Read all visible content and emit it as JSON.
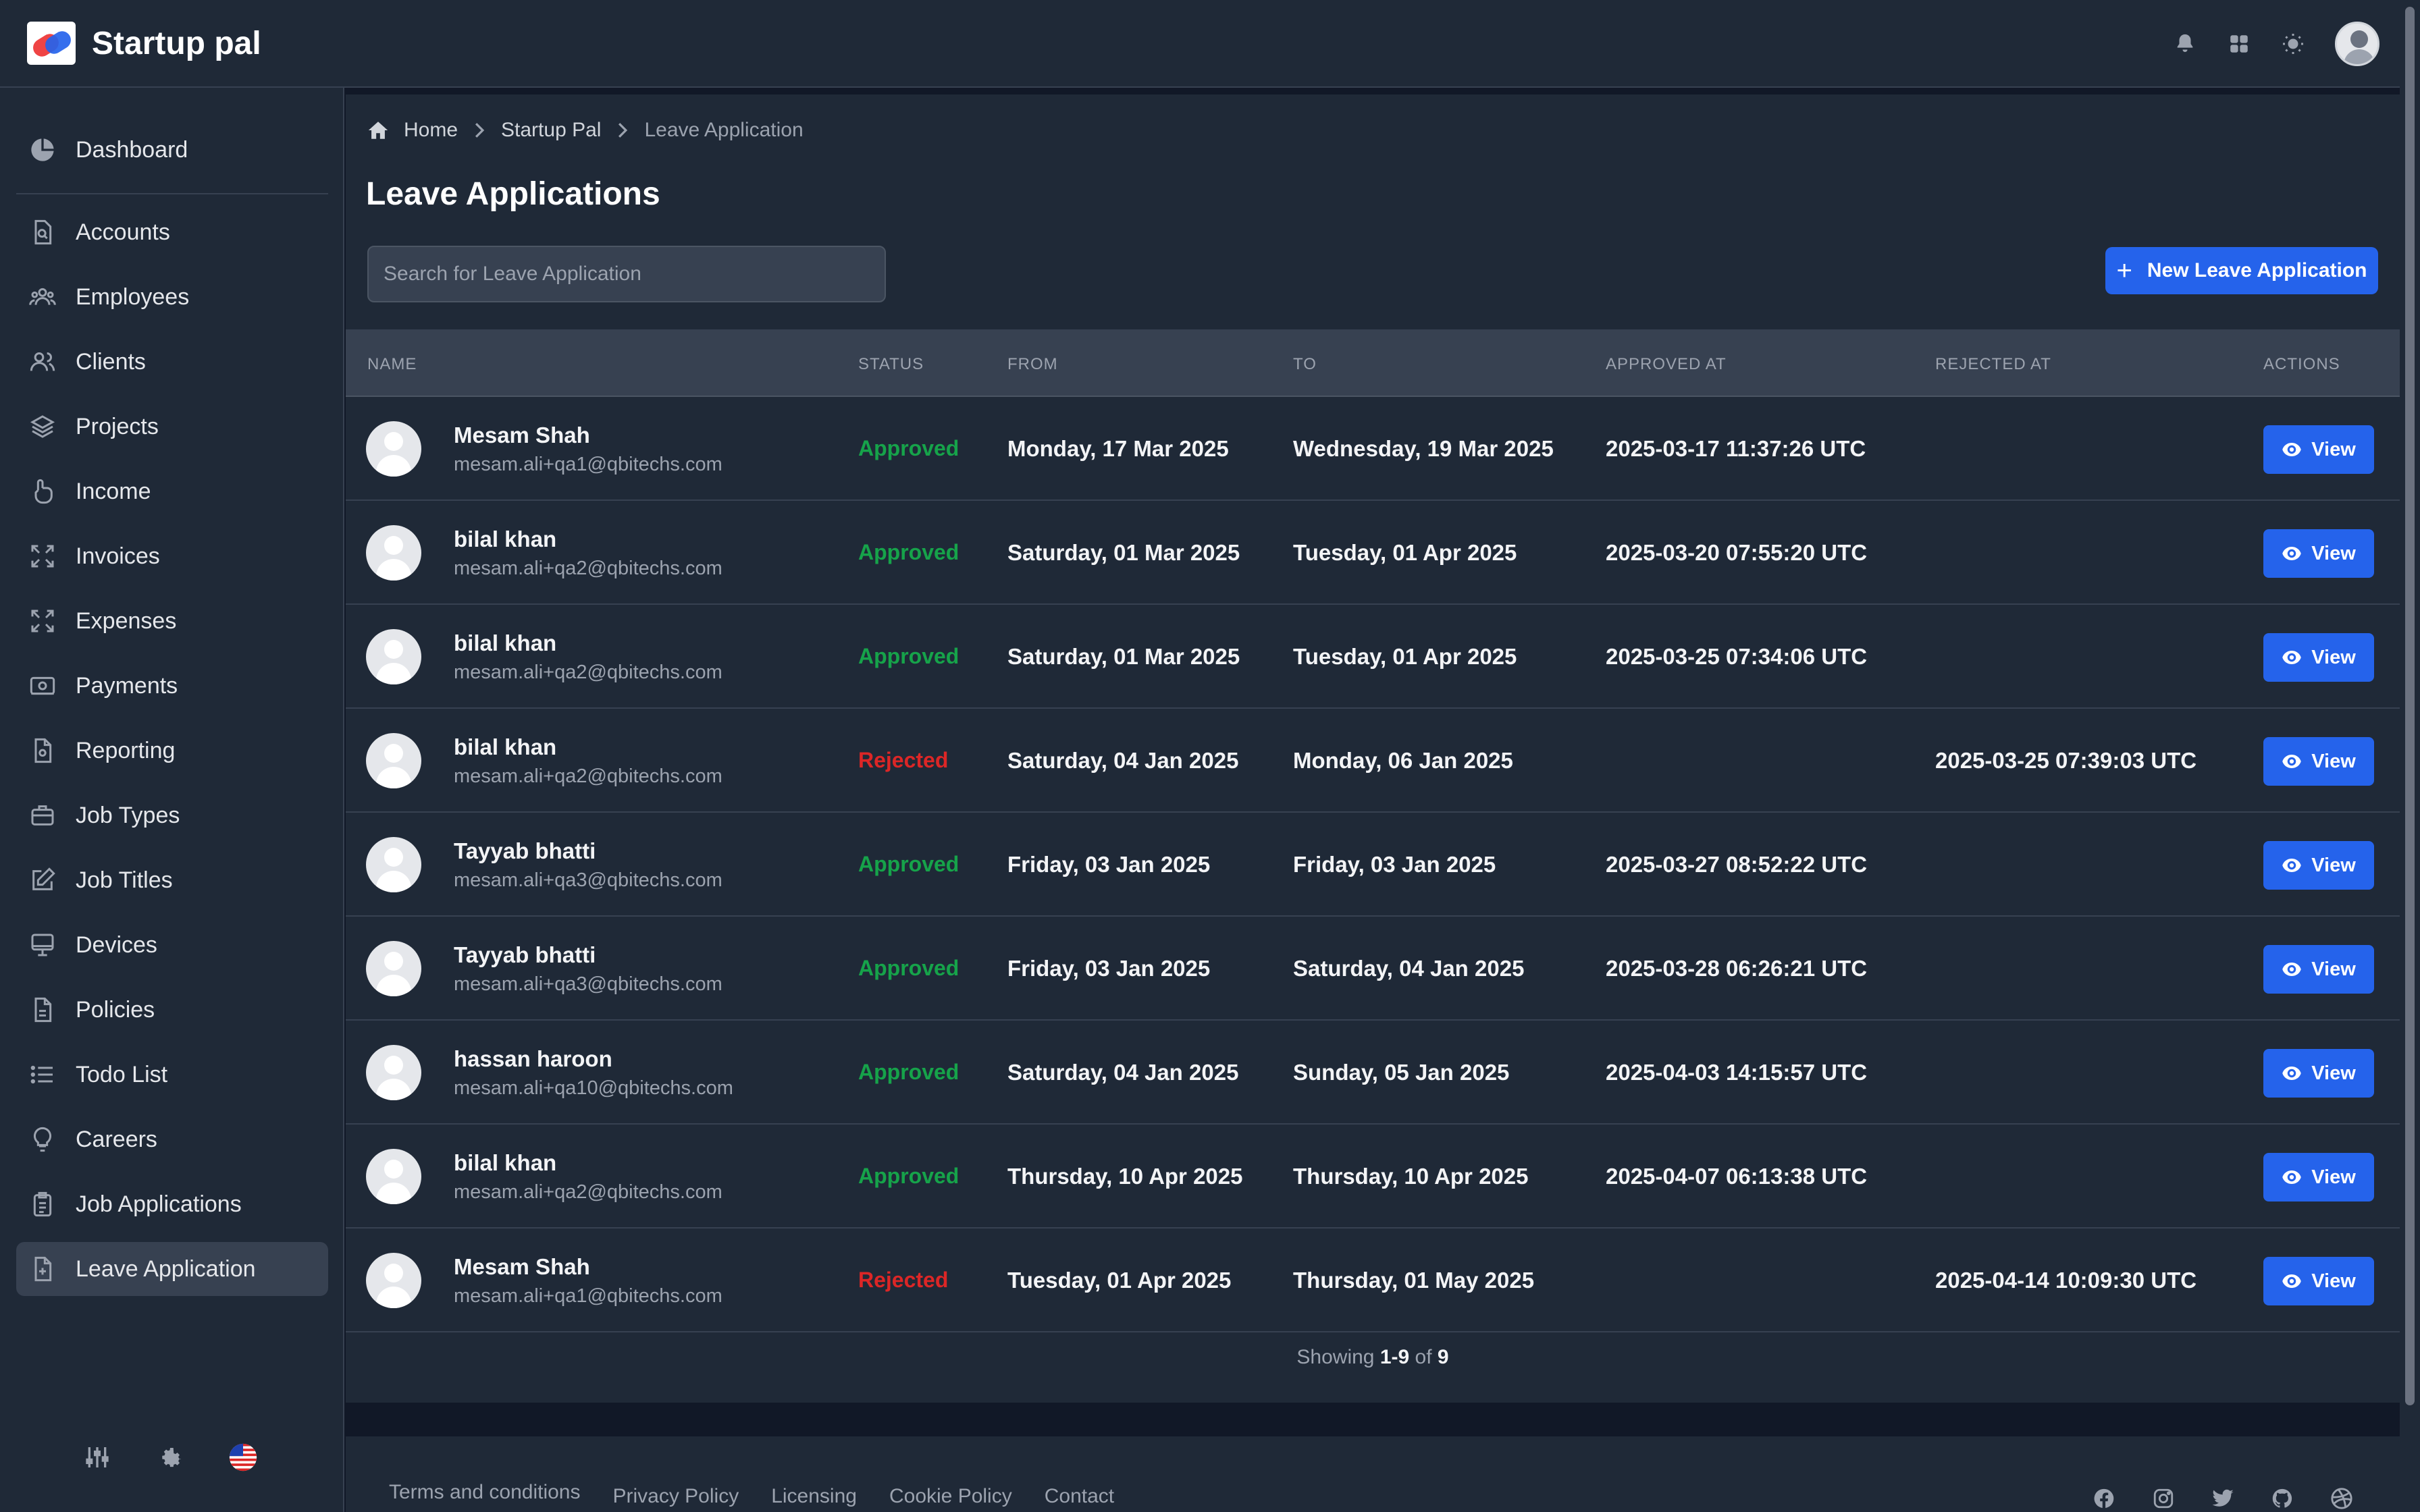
{
  "app": {
    "title": "Startup pal"
  },
  "breadcrumb": [
    "Home",
    "Startup Pal",
    "Leave Application"
  ],
  "page": {
    "title": "Leave Applications",
    "search_placeholder": "Search for Leave Application",
    "new_button_label": "New Leave Application"
  },
  "sidebar": {
    "items": [
      {
        "label": "Dashboard",
        "icon": "pie-chart-icon"
      },
      {
        "label": "Accounts",
        "icon": "document-search-icon"
      },
      {
        "label": "Employees",
        "icon": "user-group-icon"
      },
      {
        "label": "Clients",
        "icon": "users-icon"
      },
      {
        "label": "Projects",
        "icon": "layers-icon"
      },
      {
        "label": "Income",
        "icon": "hand-coin-icon"
      },
      {
        "label": "Invoices",
        "icon": "expand-icon"
      },
      {
        "label": "Expenses",
        "icon": "expand-icon"
      },
      {
        "label": "Payments",
        "icon": "cash-icon"
      },
      {
        "label": "Reporting",
        "icon": "document-icon"
      },
      {
        "label": "Job Types",
        "icon": "briefcase-icon"
      },
      {
        "label": "Job Titles",
        "icon": "pencil-square-icon"
      },
      {
        "label": "Devices",
        "icon": "monitor-icon"
      },
      {
        "label": "Policies",
        "icon": "document-text-icon"
      },
      {
        "label": "Todo List",
        "icon": "list-icon"
      },
      {
        "label": "Careers",
        "icon": "lightbulb-icon"
      },
      {
        "label": "Job Applications",
        "icon": "clipboard-icon"
      },
      {
        "label": "Leave Application",
        "icon": "document-plus-icon"
      }
    ],
    "active": "Leave Application"
  },
  "table": {
    "columns": [
      "NAME",
      "STATUS",
      "FROM",
      "TO",
      "APPROVED AT",
      "REJECTED AT",
      "ACTIONS"
    ],
    "view_label": "View",
    "rows": [
      {
        "name": "Mesam Shah",
        "email": "mesam.ali+qa1@qbitechs.com",
        "status": "Approved",
        "from": "Monday, 17 Mar 2025",
        "to": "Wednesday, 19 Mar 2025",
        "approved_at": "2025-03-17 11:37:26 UTC",
        "rejected_at": ""
      },
      {
        "name": "bilal khan",
        "email": "mesam.ali+qa2@qbitechs.com",
        "status": "Approved",
        "from": "Saturday, 01 Mar 2025",
        "to": "Tuesday, 01 Apr 2025",
        "approved_at": "2025-03-20 07:55:20 UTC",
        "rejected_at": ""
      },
      {
        "name": "bilal khan",
        "email": "mesam.ali+qa2@qbitechs.com",
        "status": "Approved",
        "from": "Saturday, 01 Mar 2025",
        "to": "Tuesday, 01 Apr 2025",
        "approved_at": "2025-03-25 07:34:06 UTC",
        "rejected_at": ""
      },
      {
        "name": "bilal khan",
        "email": "mesam.ali+qa2@qbitechs.com",
        "status": "Rejected",
        "from": "Saturday, 04 Jan 2025",
        "to": "Monday, 06 Jan 2025",
        "approved_at": "",
        "rejected_at": "2025-03-25 07:39:03 UTC"
      },
      {
        "name": "Tayyab bhatti",
        "email": "mesam.ali+qa3@qbitechs.com",
        "status": "Approved",
        "from": "Friday, 03 Jan 2025",
        "to": "Friday, 03 Jan 2025",
        "approved_at": "2025-03-27 08:52:22 UTC",
        "rejected_at": ""
      },
      {
        "name": "Tayyab bhatti",
        "email": "mesam.ali+qa3@qbitechs.com",
        "status": "Approved",
        "from": "Friday, 03 Jan 2025",
        "to": "Saturday, 04 Jan 2025",
        "approved_at": "2025-03-28 06:26:21 UTC",
        "rejected_at": ""
      },
      {
        "name": "hassan haroon",
        "email": "mesam.ali+qa10@qbitechs.com",
        "status": "Approved",
        "from": "Saturday, 04 Jan 2025",
        "to": "Sunday, 05 Jan 2025",
        "approved_at": "2025-04-03 14:15:57 UTC",
        "rejected_at": ""
      },
      {
        "name": "bilal khan",
        "email": "mesam.ali+qa2@qbitechs.com",
        "status": "Approved",
        "from": "Thursday, 10 Apr 2025",
        "to": "Thursday, 10 Apr 2025",
        "approved_at": "2025-04-07 06:13:38 UTC",
        "rejected_at": ""
      },
      {
        "name": "Mesam Shah",
        "email": "mesam.ali+qa1@qbitechs.com",
        "status": "Rejected",
        "from": "Tuesday, 01 Apr 2025",
        "to": "Thursday, 01 May 2025",
        "approved_at": "",
        "rejected_at": "2025-04-14 10:09:30 UTC"
      }
    ]
  },
  "pagination": {
    "prefix": "Showing",
    "range": "1-9",
    "of": "of",
    "total": "9"
  },
  "footer": {
    "links": [
      "Terms and conditions",
      "Privacy Policy",
      "Licensing",
      "Cookie Policy",
      "Contact"
    ],
    "social_icons": [
      "facebook-icon",
      "instagram-icon",
      "twitter-icon",
      "github-icon",
      "dribbble-icon"
    ]
  },
  "colors": {
    "accent": "#2563eb",
    "approved": "#16a34a",
    "rejected": "#dc2626",
    "background": "#1f2937"
  }
}
